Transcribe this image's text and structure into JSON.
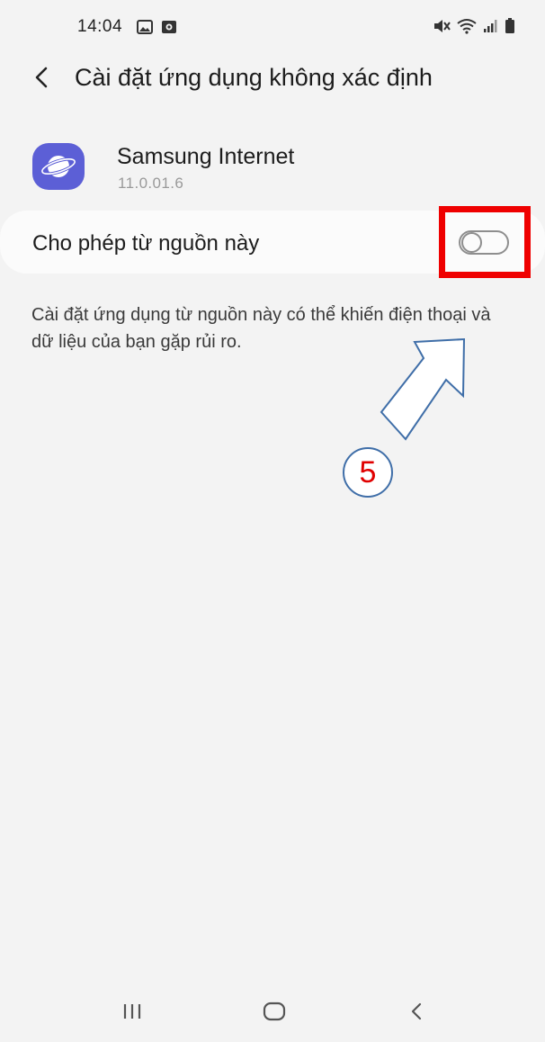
{
  "status_bar": {
    "time": "14:04",
    "left_icons": [
      "image-icon",
      "screenshot-icon"
    ],
    "right_icons": [
      "mute-icon",
      "wifi-icon",
      "signal-icon",
      "battery-icon"
    ]
  },
  "header": {
    "back_icon": "back-arrow-icon",
    "title": "Cài đặt ứng dụng không xác định"
  },
  "app": {
    "name": "Samsung Internet",
    "version": "11.0.01.6",
    "icon": "samsung-internet-icon",
    "icon_color": "#5c5fd6"
  },
  "allow_setting": {
    "label": "Cho phép từ nguồn này",
    "enabled": false
  },
  "warning": {
    "text": "Cài đặt ứng dụng từ nguồn này có thể khiến điện thoại và dữ liệu của bạn gặp rủi ro."
  },
  "annotation": {
    "step_number": "5",
    "highlight_color": "#ef0000",
    "arrow_color": "#3f6ea8"
  },
  "nav_bar": {
    "items": [
      "recent-apps-icon",
      "home-icon",
      "back-icon"
    ]
  }
}
